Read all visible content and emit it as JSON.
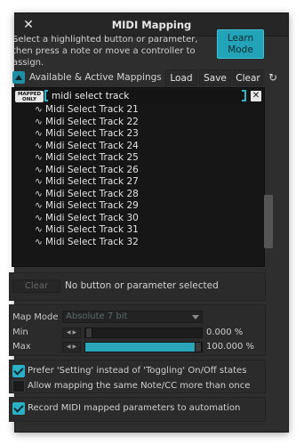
{
  "window": {
    "title": "MIDI Mapping",
    "close_icon": "close-icon"
  },
  "instructions": "Select a highlighted button or parameter, then press a note or move a controller to assign.",
  "learn_button": "Learn Mode",
  "mappings": {
    "header_label": "Available & Active Mappings",
    "load_label": "Load",
    "save_label": "Save",
    "clear_label": "Clear",
    "refresh_icon": "refresh-icon",
    "mapped_only_badge": "MAPPED ONLY",
    "search_value": "midi select track",
    "items": [
      "Midi Select Track 21",
      "Midi Select Track 22",
      "Midi Select Track 23",
      "Midi Select Track 24",
      "Midi Select Track 25",
      "Midi Select Track 26",
      "Midi Select Track 27",
      "Midi Select Track 28",
      "Midi Select Track 29",
      "Midi Select Track 30",
      "Midi Select Track 31",
      "Midi Select Track 32"
    ],
    "item_prefix": "∿"
  },
  "selection": {
    "clear_label": "Clear",
    "status": "No button or parameter selected"
  },
  "settings": {
    "map_mode_label": "Map Mode",
    "map_mode_value": "Absolute 7 bit",
    "min_label": "Min",
    "min_value": "0.000 %",
    "min_fraction": 0.0,
    "max_label": "Max",
    "max_value": "100.000 %",
    "max_fraction": 1.0
  },
  "options": {
    "prefer_setting": "Prefer 'Setting' instead of 'Toggling' On/Off states",
    "prefer_setting_checked": true,
    "allow_multi": "Allow mapping the same Note/CC more than once",
    "allow_multi_checked": false,
    "record_automation": "Record MIDI mapped parameters to automation",
    "record_automation_checked": true
  },
  "colors": {
    "accent": "#2ab1c6",
    "window_bg": "#2e2e2e",
    "list_bg": "#161616"
  }
}
